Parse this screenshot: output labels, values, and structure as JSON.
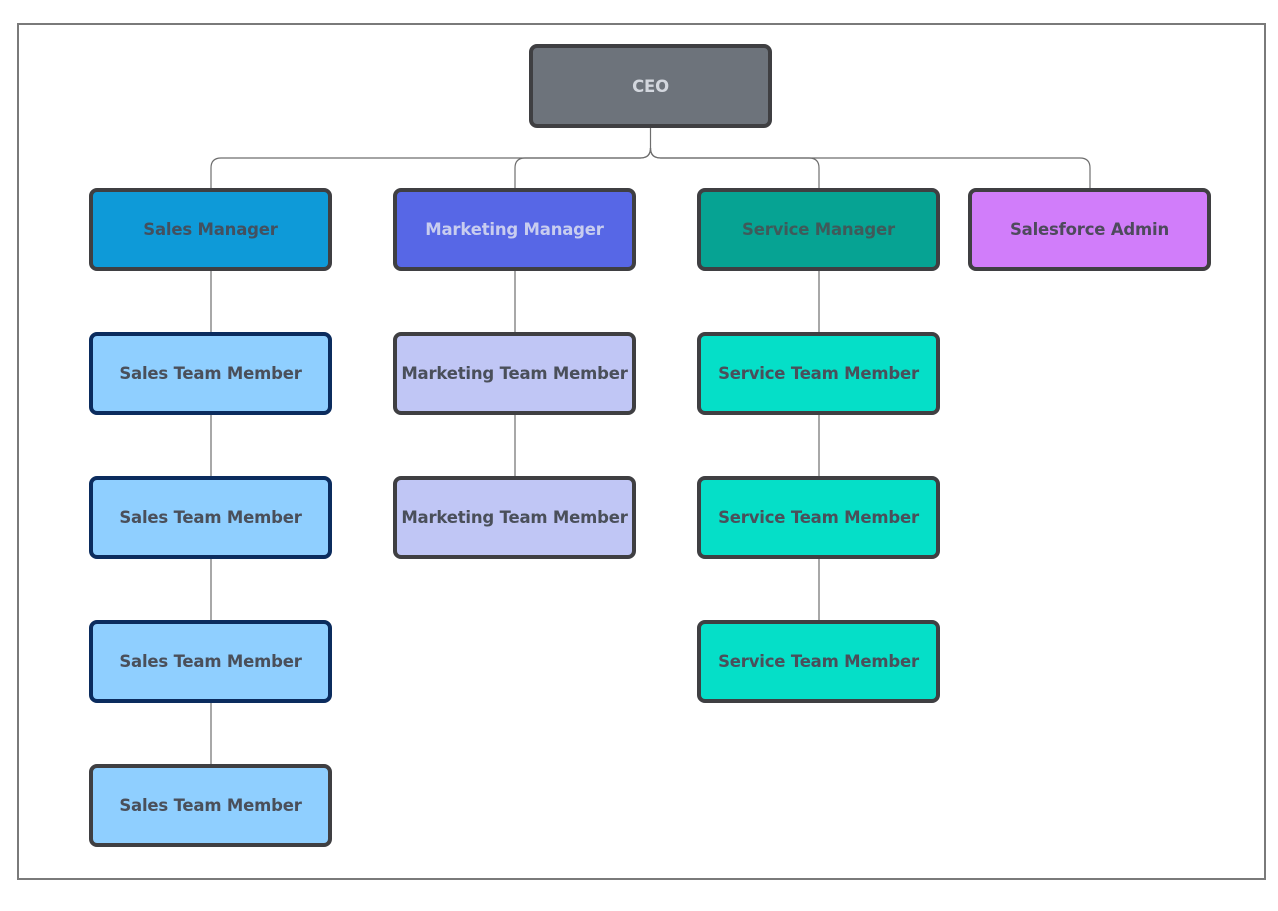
{
  "diagram": {
    "type": "org-chart",
    "nodes": {
      "ceo": {
        "label": "CEO",
        "fill": "#6d737b",
        "border": "#3f3f42",
        "text_color": "#d3d7de"
      },
      "sales_manager": {
        "label": "Sales Manager",
        "fill": "#0e9ad8",
        "border": "#3f3f42",
        "text_color": "#43505f"
      },
      "marketing_manager": {
        "label": "Marketing Manager",
        "fill": "#5767e6",
        "border": "#3f3f42",
        "text_color": "#c8cdef"
      },
      "service_manager": {
        "label": "Service Manager",
        "fill": "#06a393",
        "border": "#3f3f42",
        "text_color": "#3f5a5a"
      },
      "salesforce_admin": {
        "label": "Salesforce Admin",
        "fill": "#d17dfa",
        "border": "#3f3f42",
        "text_color": "#4e4a5c"
      },
      "sales_members": [
        {
          "label": "Sales Team Member",
          "fill": "#8fcfff",
          "border": "#0b2c5e",
          "text_color": "#4a4f5a"
        },
        {
          "label": "Sales Team Member",
          "fill": "#8fcfff",
          "border": "#0b2c5e",
          "text_color": "#4a4f5a"
        },
        {
          "label": "Sales Team Member",
          "fill": "#8fcfff",
          "border": "#0b2c5e",
          "text_color": "#4a4f5a"
        },
        {
          "label": "Sales Team Member",
          "fill": "#8fcfff",
          "border": "#3f3f42",
          "text_color": "#4a4f5a"
        }
      ],
      "marketing_members": [
        {
          "label": "Marketing Team Member",
          "fill": "#c0c6f5",
          "border": "#3f3f42",
          "text_color": "#4a4f5a"
        },
        {
          "label": "Marketing Team Member",
          "fill": "#c0c6f5",
          "border": "#3f3f42",
          "text_color": "#4a4f5a"
        }
      ],
      "service_members": [
        {
          "label": "Service Team Member",
          "fill": "#05dfc8",
          "border": "#3f3f42",
          "text_color": "#4a4f5a"
        },
        {
          "label": "Service Team Member",
          "fill": "#05dfc8",
          "border": "#3f3f42",
          "text_color": "#4a4f5a"
        },
        {
          "label": "Service Team Member",
          "fill": "#05dfc8",
          "border": "#3f3f42",
          "text_color": "#4a4f5a"
        }
      ]
    },
    "edges": [
      [
        "CEO",
        "Sales Manager"
      ],
      [
        "CEO",
        "Marketing Manager"
      ],
      [
        "CEO",
        "Service Manager"
      ],
      [
        "CEO",
        "Salesforce Admin"
      ],
      [
        "Sales Manager",
        "Sales Team Member 1"
      ],
      [
        "Sales Team Member 1",
        "Sales Team Member 2"
      ],
      [
        "Sales Team Member 2",
        "Sales Team Member 3"
      ],
      [
        "Sales Team Member 3",
        "Sales Team Member 4"
      ],
      [
        "Marketing Manager",
        "Marketing Team Member 1"
      ],
      [
        "Marketing Team Member 1",
        "Marketing Team Member 2"
      ],
      [
        "Service Manager",
        "Service Team Member 1"
      ],
      [
        "Service Team Member 1",
        "Service Team Member 2"
      ],
      [
        "Service Team Member 2",
        "Service Team Member 3"
      ]
    ],
    "connector_color": "#6e6e6e",
    "frame_color": "#7a7a7a"
  }
}
